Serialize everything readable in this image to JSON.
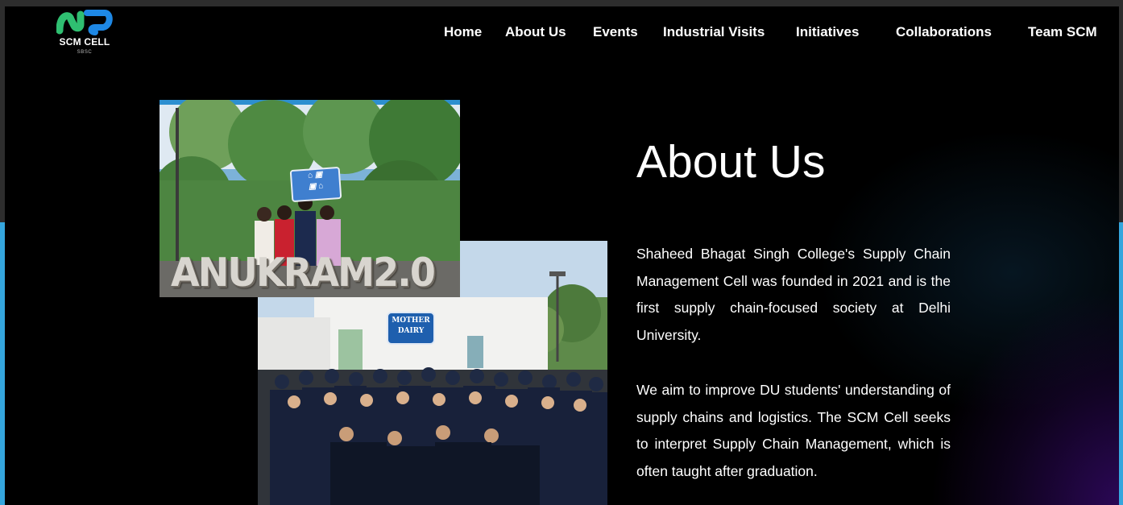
{
  "header": {
    "logo": {
      "title": "SCM CELL",
      "subtitle": "SBSC",
      "icon": "scm-logo-icon",
      "colors": [
        "#2fbf71",
        "#1e88e5"
      ]
    },
    "nav": [
      {
        "label": "Home"
      },
      {
        "label": "About Us"
      },
      {
        "label": "Events"
      },
      {
        "label": "Industrial Visits"
      },
      {
        "label": "Initiatives"
      },
      {
        "label": "Collaborations"
      },
      {
        "label": "Team SCM"
      }
    ]
  },
  "about": {
    "title": "About Us",
    "paragraphs": [
      "Shaheed Bhagat Singh College's Supply Chain Management Cell was founded in 2021 and is the first supply chain-focused society at Delhi University.",
      "We aim to improve DU students' understanding of supply chains and logistics. The SCM Cell seeks to interpret Supply Chain Management, which is often taught after graduation."
    ]
  },
  "photos": {
    "event": {
      "sign_text": "ANUKRAM2.0"
    },
    "visit": {
      "sign_text": "MOTHER DAIRY"
    }
  },
  "theme": {
    "background": "#000000",
    "text": "#ffffff",
    "edge": "#35a6dd"
  }
}
